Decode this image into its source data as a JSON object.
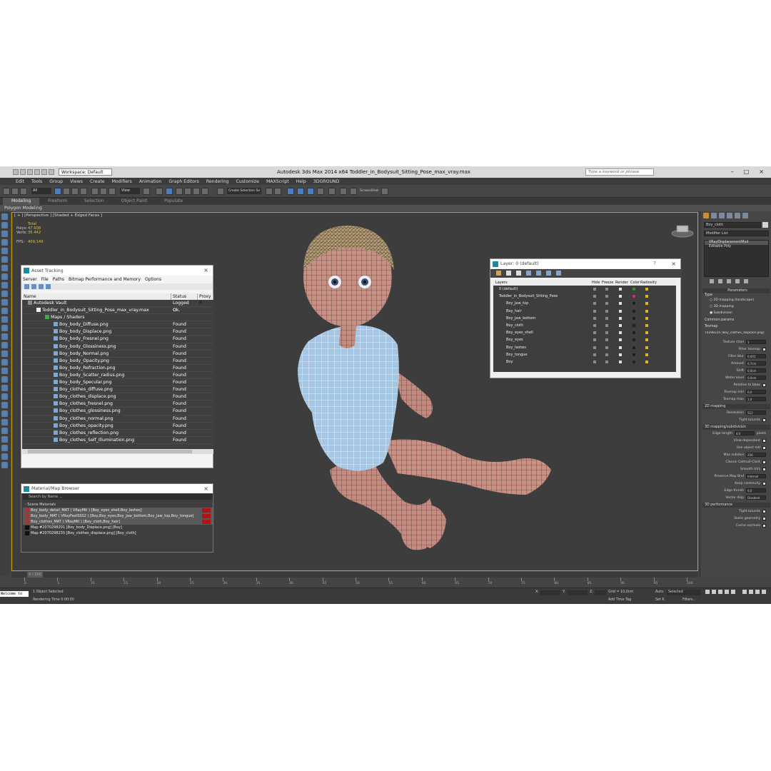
{
  "window": {
    "title": "Autodesk 3ds Max  2014 x64       Toddler_in_Bodysuit_Sitting_Pose_max_vray.max",
    "workspace": "Workspace: Default",
    "search_placeholder": "Type a keyword or phrase"
  },
  "menu": [
    "Edit",
    "Tools",
    "Group",
    "Views",
    "Create",
    "Modifiers",
    "Animation",
    "Graph Editors",
    "Rendering",
    "Customize",
    "MAXScript",
    "Help",
    "3DGROUND"
  ],
  "toolbar": {
    "selection_filter": "All",
    "ref_coord": "View",
    "named_sel": "Create Selection Se",
    "screenshot": "ScreenShot"
  },
  "ribbon": {
    "tabs": [
      "Modeling",
      "Freeform",
      "Selection",
      "Object Paint",
      "Populate"
    ],
    "active": "Modeling",
    "sub": "Polygon Modeling"
  },
  "viewport": {
    "label": "[ + ] [Perspective ] [Shaded + Edged Faces ]",
    "stats": {
      "header": "Total",
      "polys_label": "Polys:",
      "polys": "47 608",
      "verts_label": "Verts:",
      "verts": "35 442",
      "fps_label": "FPS:",
      "fps": "409,149"
    }
  },
  "asset_tracking": {
    "title": "Asset Tracking",
    "menu": [
      "Server",
      "File",
      "Paths",
      "Bitmap Performance and Memory",
      "Options"
    ],
    "columns": [
      "Name",
      "Status",
      "Proxy R"
    ],
    "rows": [
      {
        "name": "Autodesk Vault",
        "status": "Logged O...",
        "indent": 0
      },
      {
        "name": "Toddler_in_Bodysuit_Sitting_Pose_max_vray.max",
        "status": "Ok",
        "indent": 1
      },
      {
        "name": "Maps / Shaders",
        "status": "",
        "indent": 2
      },
      {
        "name": "Boy_body_Diffuse.png",
        "status": "Found",
        "indent": 3
      },
      {
        "name": "Boy_body_Displace.png",
        "status": "Found",
        "indent": 3
      },
      {
        "name": "Boy_body_Fresnel.png",
        "status": "Found",
        "indent": 3
      },
      {
        "name": "Boy_body_Glossiness.png",
        "status": "Found",
        "indent": 3
      },
      {
        "name": "Boy_body_Normal.png",
        "status": "Found",
        "indent": 3
      },
      {
        "name": "Boy_body_Opacity.png",
        "status": "Found",
        "indent": 3
      },
      {
        "name": "Boy_body_Refraction.png",
        "status": "Found",
        "indent": 3
      },
      {
        "name": "Boy_body_Scatter_radius.png",
        "status": "Found",
        "indent": 3
      },
      {
        "name": "Boy_body_Specular.png",
        "status": "Found",
        "indent": 3
      },
      {
        "name": "Boy_clothes_diffuse.png",
        "status": "Found",
        "indent": 3
      },
      {
        "name": "Boy_clothes_displace.png",
        "status": "Found",
        "indent": 3
      },
      {
        "name": "Boy_clothes_fresnel.png",
        "status": "Found",
        "indent": 3
      },
      {
        "name": "Boy_clothes_glossiness.png",
        "status": "Found",
        "indent": 3
      },
      {
        "name": "Boy_clothes_normal.png",
        "status": "Found",
        "indent": 3
      },
      {
        "name": "Boy_clothes_opacity.png",
        "status": "Found",
        "indent": 3
      },
      {
        "name": "Boy_clothes_reflection.png",
        "status": "Found",
        "indent": 3
      },
      {
        "name": "Boy_clothes_Self_Illumination.png",
        "status": "Found",
        "indent": 3
      }
    ]
  },
  "material_browser": {
    "title": "Material/Map Browser",
    "search": "Search by Name ...",
    "section": "- Scene Materials",
    "rows": [
      "Boy_body_detail_MAT ( VRayMtl ) [Boy_eyes_shell,Boy_lashes]",
      "Boy_body_MAT ( VRayFastSSS2 ) [Boy,Boy_eyes,Boy_Jaw_bottom,Boy_Jaw_top,Boy_tongue]",
      "Boy_clothes_MAT ( VRayMtl ) [Boy_cloth,Boy_hair]",
      "Map #2070298201 [Boy_body_Displace.png] [Boy]",
      "Map #2070298235 [Boy_clothes_displace.png] [Boy_cloth]"
    ]
  },
  "layers": {
    "title": "Layer: 0 (default)",
    "columns": [
      "Layers",
      "Hide",
      "Freeze",
      "Render",
      "Color",
      "Radiosity"
    ],
    "rows": [
      {
        "name": "0 (default)",
        "indent": 0,
        "color": "#2e8b3a"
      },
      {
        "name": "Toddler_in_Bodysuit_Sitting_Pose",
        "indent": 0,
        "color": "#c2307a"
      },
      {
        "name": "Boy_Jaw_top",
        "indent": 1,
        "color": "#222222"
      },
      {
        "name": "Boy_hair",
        "indent": 1,
        "color": "#222222"
      },
      {
        "name": "Boy_Jaw_bottom",
        "indent": 1,
        "color": "#222222"
      },
      {
        "name": "Boy_cloth",
        "indent": 1,
        "color": "#222222"
      },
      {
        "name": "Boy_eyes_shell",
        "indent": 1,
        "color": "#222222"
      },
      {
        "name": "Boy_eyes",
        "indent": 1,
        "color": "#222222"
      },
      {
        "name": "Boy_lashes",
        "indent": 1,
        "color": "#222222"
      },
      {
        "name": "Boy_tongue",
        "indent": 1,
        "color": "#222222"
      },
      {
        "name": "Boy",
        "indent": 1,
        "color": "#222222"
      }
    ]
  },
  "command_panel": {
    "object_name": "Boy_cloth",
    "modifier_list": "Modifier List",
    "stack": [
      "VRayDisplacementMod",
      "Editable Poly"
    ],
    "params_title": "Parameters",
    "type_label": "Type",
    "type_options": [
      "2D mapping (landscape)",
      "3D mapping",
      "Subdivision"
    ],
    "common_label": "Common params",
    "texmap_label": "Texmap",
    "texmap_value": "70298235 (Boy_clothes_displace.png)",
    "fields": [
      {
        "label": "Texture chan",
        "value": "1"
      },
      {
        "label": "Filter texmap",
        "value": ""
      },
      {
        "label": "Filter blur",
        "value": "0,001"
      },
      {
        "label": "Amount",
        "value": "0,7cm"
      },
      {
        "label": "Shift",
        "value": "0,0cm"
      },
      {
        "label": "Water level",
        "value": "0,0cm"
      },
      {
        "label": "Relative to bbox",
        "value": ""
      },
      {
        "label": "Texmap min",
        "value": "0,0"
      },
      {
        "label": "Texmap max",
        "value": "1,0"
      }
    ],
    "section_2d": "2D mapping",
    "res_label": "Resolution",
    "res_value": "512",
    "tight": "Tight bounds",
    "section_3d": "3D mapping/subdivision",
    "fields3d": [
      {
        "label": "Edge length",
        "value": "4,0",
        "suffix": "pixels"
      },
      {
        "label": "View-dependent",
        "value": ""
      },
      {
        "label": "Use object mtl",
        "value": ""
      },
      {
        "label": "Max subdivs",
        "value": "256"
      },
      {
        "label": "Classic Catmull-Clark",
        "value": ""
      },
      {
        "label": "Smooth UVs",
        "value": ""
      },
      {
        "label": "Preserve Map Bnd",
        "value": "Internal"
      },
      {
        "label": "Keep continuity",
        "value": ""
      },
      {
        "label": "Edge thresh",
        "value": "0,0"
      },
      {
        "label": "Vector disp",
        "value": "Disabled"
      }
    ],
    "section_perf": "3D performance",
    "perf": [
      "Tight bounds",
      "Static geometry",
      "Cache normals"
    ]
  },
  "timeline": {
    "frame": "0 / 100",
    "ticks": [
      "0",
      "5",
      "10",
      "15",
      "20",
      "25",
      "30",
      "35",
      "40",
      "45",
      "50",
      "55",
      "60",
      "65",
      "70",
      "75",
      "80",
      "85",
      "90",
      "95",
      "100"
    ]
  },
  "status": {
    "welcome": "Welcome to",
    "selected": "1 Object Selected",
    "render_time": "Rendering Time  0:00:00",
    "x_label": "X:",
    "y_label": "Y:",
    "z_label": "Z:",
    "grid": "Grid = 10,0cm",
    "add_time_tag": "Add Time Tag",
    "auto": "Auto",
    "selected_dd": "Selected",
    "setk": "Set K.",
    "filters": "Filters..."
  }
}
